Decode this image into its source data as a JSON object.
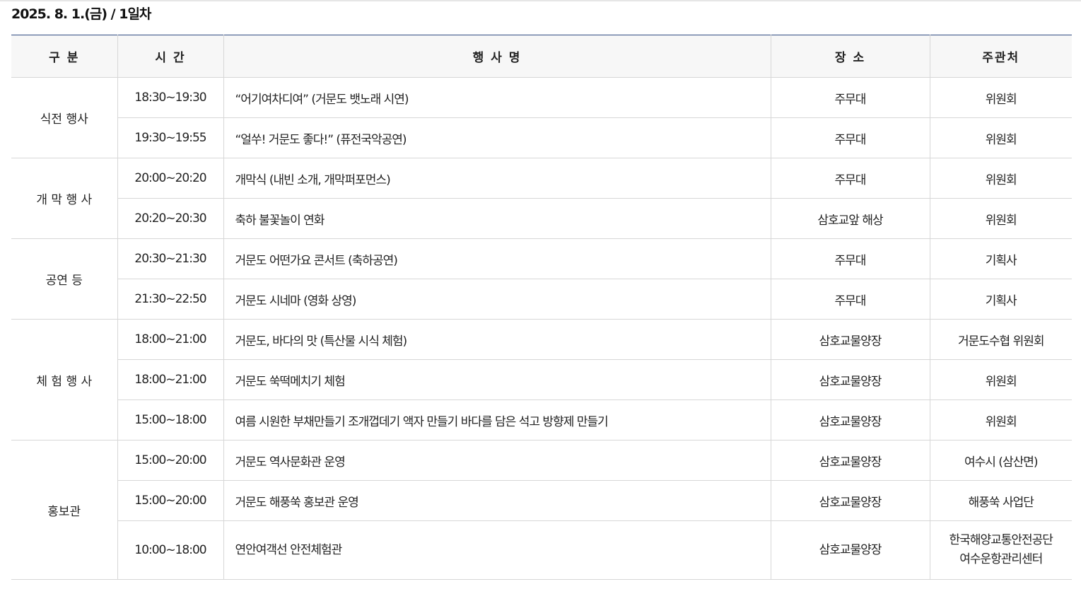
{
  "day_title": "2025. 8. 1.(금) / 1일차",
  "headers": [
    "구 분",
    "시 간",
    "행 사 명",
    "장 소",
    "주관처"
  ],
  "groups": [
    {
      "category": "식전 행사",
      "rows": [
        {
          "time": "18:30~19:30",
          "event": "“어기여차디여” (거문도 뱃노래 시연)",
          "place": "주무대",
          "host": "위원회"
        },
        {
          "time": "19:30~19:55",
          "event": "“얼쑤! 거문도 좋다!” (퓨전국악공연)",
          "place": "주무대",
          "host": "위원회"
        }
      ]
    },
    {
      "category": "개 막 행 사",
      "rows": [
        {
          "time": "20:00~20:20",
          "event": "개막식 (내빈 소개, 개막퍼포먼스)",
          "place": "주무대",
          "host": "위원회"
        },
        {
          "time": "20:20~20:30",
          "event": "축하 불꽃놀이 연화",
          "place": "삼호교앞 해상",
          "host": "위원회"
        }
      ]
    },
    {
      "category": "공연 등",
      "rows": [
        {
          "time": "20:30~21:30",
          "event": "거문도 어떤가요 콘서트 (축하공연)",
          "place": "주무대",
          "host": "기획사"
        },
        {
          "time": "21:30~22:50",
          "event": "거문도 시네마 (영화 상영)",
          "place": "주무대",
          "host": "기획사"
        }
      ]
    },
    {
      "category": "체 험 행 사",
      "rows": [
        {
          "time": "18:00~21:00",
          "event": "거문도, 바다의 맛 (특산물 시식 체험)",
          "place": "삼호교물양장",
          "host": "거문도수협 위원회"
        },
        {
          "time": "18:00~21:00",
          "event": "거문도 쑥떡메치기 체험",
          "place": "삼호교물양장",
          "host": "위원회"
        },
        {
          "time": "15:00~18:00",
          "event": "여름 시원한 부채만들기 조개껍데기 액자 만들기 바다를 담은 석고 방향제 만들기",
          "place": "삼호교물양장",
          "host": "위원회"
        }
      ]
    },
    {
      "category": "홍보관",
      "rows": [
        {
          "time": "15:00~20:00",
          "event": "거문도 역사문화관 운영",
          "place": "삼호교물양장",
          "host": "여수시 (삼산면)"
        },
        {
          "time": "15:00~20:00",
          "event": "거문도 해풍쑥 홍보관 운영",
          "place": "삼호교물양장",
          "host": "해풍쑥 사업단"
        },
        {
          "time": "10:00~18:00",
          "event": "연안여객선 안전체험관",
          "place": "삼호교물양장",
          "host_lines": [
            "한국해양교통안전공단",
            "여수운항관리센터"
          ]
        }
      ]
    }
  ]
}
